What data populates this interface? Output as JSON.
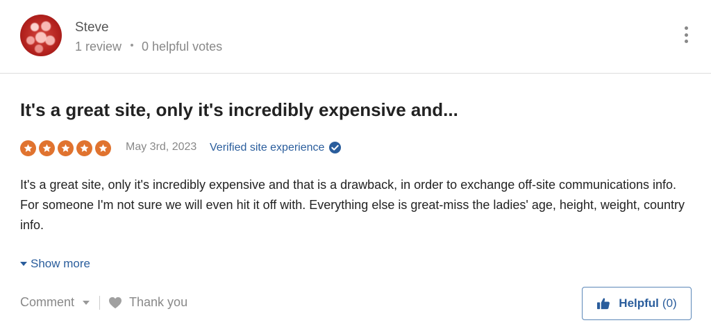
{
  "reviewer": {
    "name": "Steve",
    "review_count": "1 review",
    "helpful_votes": "0 helpful votes"
  },
  "review": {
    "title": "It's a great site, only it's incredibly expensive and...",
    "rating": 5,
    "date": "May 3rd, 2023",
    "verified_label": "Verified site experience",
    "body": "It's a great site, only it's incredibly expensive and that is a drawback, in order to exchange off-site communications info. For someone I'm not sure we will even hit it off with. Everything else is great-miss the ladies' age, height, weight, country info.",
    "show_more_label": "Show more"
  },
  "actions": {
    "comment_label": "Comment",
    "thank_label": "Thank you",
    "helpful_label": "Helpful",
    "helpful_count": "(0)"
  },
  "icons": {
    "more": "vertical-ellipsis-icon",
    "verified": "check-badge-icon",
    "show_more": "caret-down-icon",
    "comment": "caret-down-icon",
    "thank": "heart-icon",
    "helpful": "thumbs-up-icon",
    "star": "star-icon"
  },
  "colors": {
    "star": "#e0732f",
    "link": "#2a5d9c",
    "muted": "#888888",
    "avatar": "#b3221e"
  }
}
